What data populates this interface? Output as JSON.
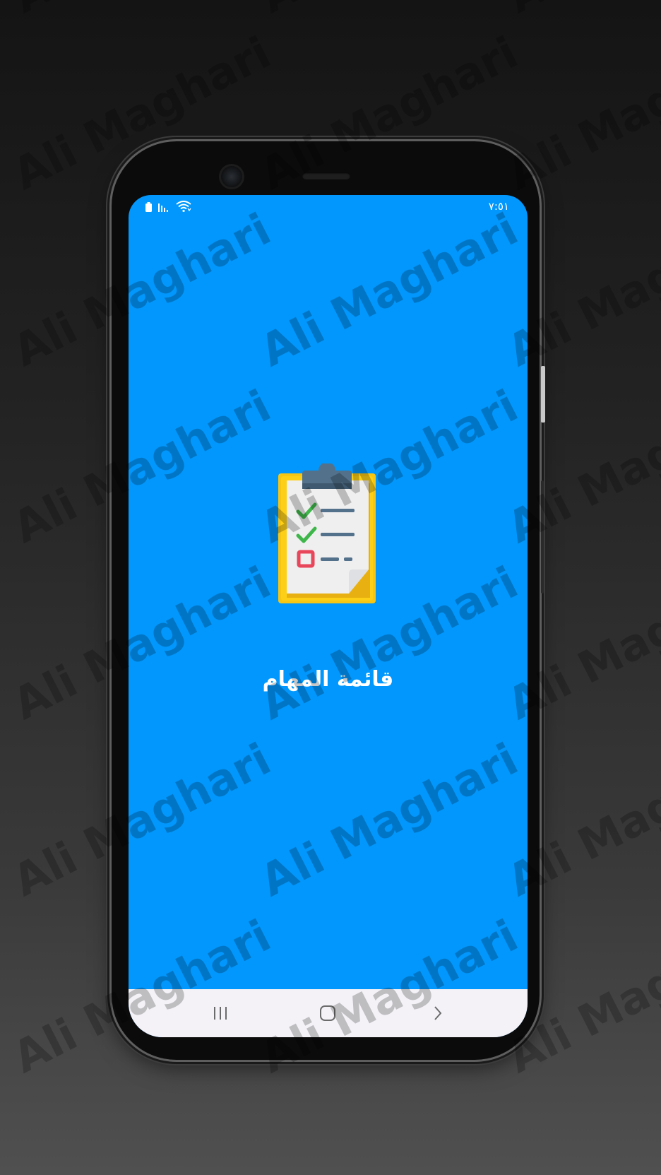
{
  "status_bar": {
    "time": "٧:٥١",
    "icons": [
      "battery-icon",
      "signal-icon",
      "wifi-icon"
    ]
  },
  "splash": {
    "logo_icon": "clipboard-checklist-icon",
    "title": "قائمة المهام"
  },
  "nav_bar": {
    "buttons": [
      "recent-apps-icon",
      "home-icon",
      "back-icon"
    ]
  },
  "watermark": {
    "text": "Ali Maghari"
  },
  "colors": {
    "screen_background": "#0197fd",
    "nav_bar_background": "#f4f2f7",
    "title_text": "#ffffff"
  }
}
